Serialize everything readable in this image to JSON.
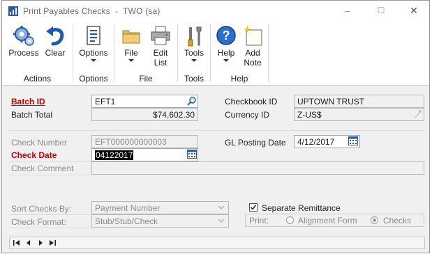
{
  "window": {
    "title": "Print Payables Checks  -  TWO (sa)",
    "controls": {
      "minimize": "–",
      "maximize": "☐",
      "close": "✕"
    }
  },
  "ribbon": {
    "groups": [
      {
        "label": "Actions",
        "buttons": [
          {
            "label": "Process",
            "icon": "gears-icon"
          },
          {
            "label": "Clear",
            "icon": "undo-arrow-icon"
          }
        ]
      },
      {
        "label": "Options",
        "buttons": [
          {
            "label": "Options",
            "icon": "document-list-icon"
          }
        ]
      },
      {
        "label": "File",
        "buttons": [
          {
            "label": "File",
            "icon": "folder-icon"
          },
          {
            "label": "Edit\nList",
            "icon": "printer-icon"
          }
        ]
      },
      {
        "label": "Tools",
        "buttons": [
          {
            "label": "Tools",
            "icon": "tools-icon"
          }
        ]
      },
      {
        "label": "Help",
        "buttons": [
          {
            "label": "Help",
            "icon": "help-icon"
          },
          {
            "label": "Add\nNote",
            "icon": "note-icon"
          }
        ]
      }
    ]
  },
  "form": {
    "batch_id_label": "Batch ID",
    "batch_id_value": "EFT1",
    "batch_total_label": "Batch Total",
    "batch_total_value": "$74,602.30",
    "checkbook_id_label": "Checkbook ID",
    "checkbook_id_value": "UPTOWN TRUST",
    "currency_id_label": "Currency ID",
    "currency_id_value": "Z-US$",
    "check_number_label": "Check Number",
    "check_number_value": "EFT000000000003",
    "gl_posting_date_label": "GL Posting Date",
    "gl_posting_date_value": "4/12/2017",
    "check_date_label": "Check Date",
    "check_date_value": "04122017",
    "check_comment_label": "Check Comment",
    "check_comment_value": "",
    "sort_checks_label": "Sort Checks By:",
    "sort_checks_value": "Payment Number",
    "check_format_label": "Check Format:",
    "check_format_value": "Stub/Stub/Check",
    "separate_remittance_label": "Separate Remittance",
    "separate_remittance_checked": true,
    "print_label": "Print:",
    "print_options": [
      "Alignment Form",
      "Checks"
    ],
    "print_selected": "Checks"
  },
  "colors": {
    "required_label": "#cc0000",
    "ribbon_icon_blue": "#1e5aa8"
  }
}
